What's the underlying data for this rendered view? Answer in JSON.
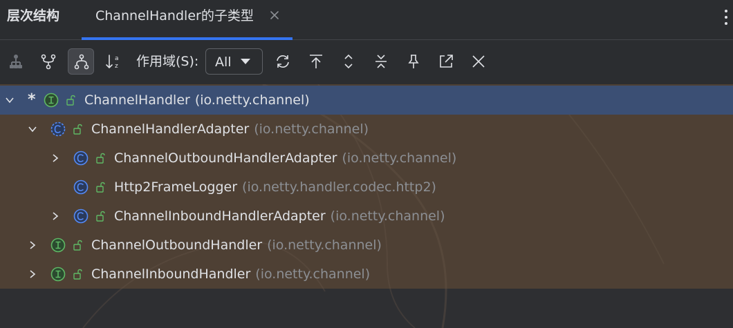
{
  "header": {
    "panel_title": "层次结构",
    "tab_label": "ChannelHandler的子类型"
  },
  "toolbar": {
    "scope_label": "作用域(S):",
    "scope_value": "All",
    "buttons": [
      "class-hierarchy-icon",
      "supertypes-hierarchy-icon",
      "subtypes-hierarchy-icon",
      "sort-alphabetically-icon",
      "refresh-icon",
      "scroll-to-top-icon",
      "expand-all-icon",
      "collapse-all-icon",
      "pin-icon",
      "open-in-new-icon",
      "close-icon"
    ]
  },
  "tree": {
    "rows": [
      {
        "name": "ChannelHandler",
        "package": "(io.netty.channel)",
        "kind": "interface",
        "expanded": true,
        "selected": true,
        "marker": "*"
      },
      {
        "name": "ChannelHandlerAdapter",
        "package": "(io.netty.channel)",
        "kind": "abstract-class",
        "expanded": true
      },
      {
        "name": "ChannelOutboundHandlerAdapter",
        "package": "(io.netty.channel)",
        "kind": "class",
        "expanded": false
      },
      {
        "name": "Http2FrameLogger",
        "package": "(io.netty.handler.codec.http2)",
        "kind": "class",
        "leaf": true
      },
      {
        "name": "ChannelInboundHandlerAdapter",
        "package": "(io.netty.channel)",
        "kind": "class",
        "expanded": false
      },
      {
        "name": "ChannelOutboundHandler",
        "package": "(io.netty.channel)",
        "kind": "interface",
        "expanded": false
      },
      {
        "name": "ChannelInboundHandler",
        "package": "(io.netty.channel)",
        "kind": "interface",
        "expanded": false
      }
    ]
  },
  "colors": {
    "accent": "#3574f0",
    "interface_icon": "#5fb865",
    "class_icon": "#548af7",
    "selection": "#3b4f74",
    "tree_background": "#4e4034"
  }
}
